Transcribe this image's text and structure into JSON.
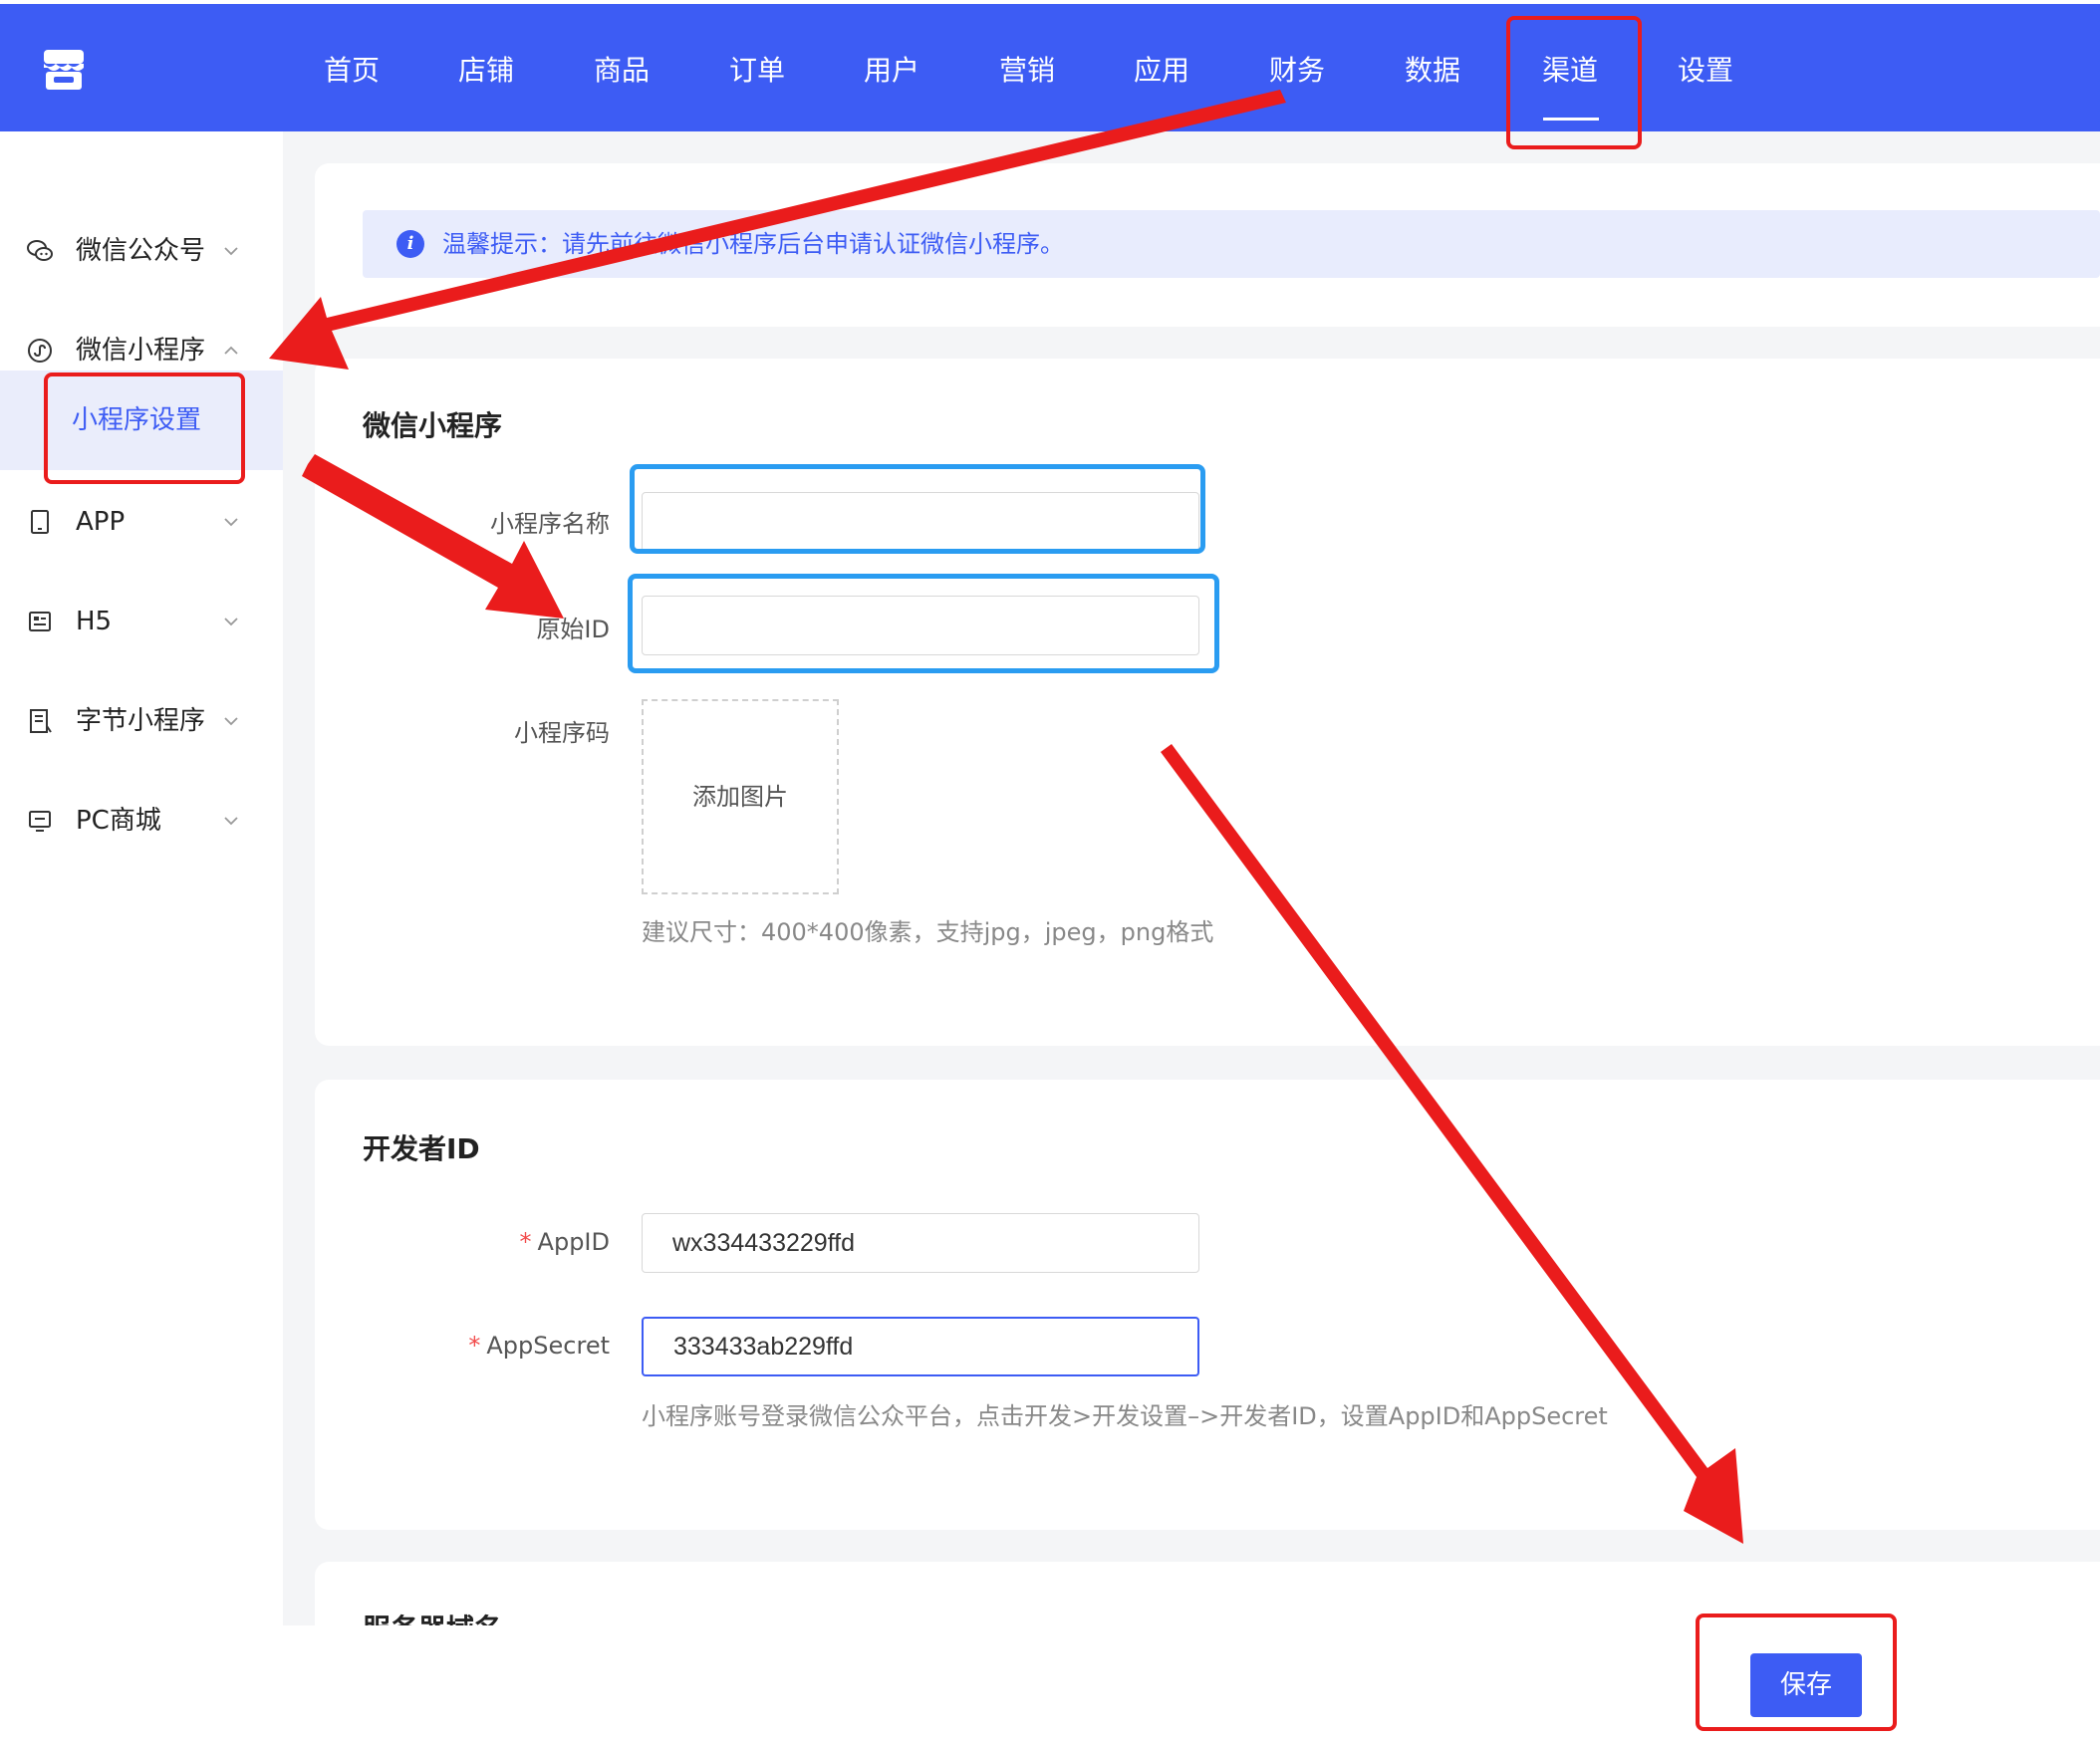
{
  "nav": {
    "items": [
      "首页",
      "店铺",
      "商品",
      "订单",
      "用户",
      "营销",
      "应用",
      "财务",
      "数据",
      "渠道",
      "设置"
    ],
    "active": "渠道"
  },
  "sidebar": {
    "items": [
      {
        "label": "微信公众号",
        "icon": "wechat-icon",
        "expanded": false
      },
      {
        "label": "微信小程序",
        "icon": "miniprogram-icon",
        "expanded": true
      },
      {
        "label": "APP",
        "icon": "tablet-icon",
        "expanded": false
      },
      {
        "label": "H5",
        "icon": "h5-icon",
        "expanded": false
      },
      {
        "label": "字节小程序",
        "icon": "bytedance-icon",
        "expanded": false
      },
      {
        "label": "PC商城",
        "icon": "monitor-icon",
        "expanded": false
      }
    ],
    "sub_item": "小程序设置"
  },
  "tip": {
    "text": "温馨提示：请先前往微信小程序后台申请认证微信小程序。"
  },
  "miniprogram_section": {
    "title": "微信小程序",
    "name_label": "小程序名称",
    "name_value": "",
    "original_id_label": "原始ID",
    "original_id_value": "",
    "code_label": "小程序码",
    "upload_text": "添加图片",
    "upload_hint": "建议尺寸：400*400像素，支持jpg，jpeg，png格式"
  },
  "developer_section": {
    "title": "开发者ID",
    "appid_label": "AppID",
    "appid_value": "wx334433229ffd",
    "appsecret_label": "AppSecret",
    "appsecret_value": "333433ab229ffd",
    "hint": "小程序账号登录微信公众平台，点击开发>开发设置–>开发者ID，设置AppID和AppSecret",
    "required_mark": "*"
  },
  "server_section": {
    "title": "服务器域名"
  },
  "actions": {
    "save_label": "保存"
  },
  "colors": {
    "primary": "#3d5cf4",
    "annotation_red": "#ea1c1c",
    "annotation_blue": "#2a9cf1",
    "tip_bg": "#e8ecfd",
    "page_bg": "#f4f5f7"
  }
}
